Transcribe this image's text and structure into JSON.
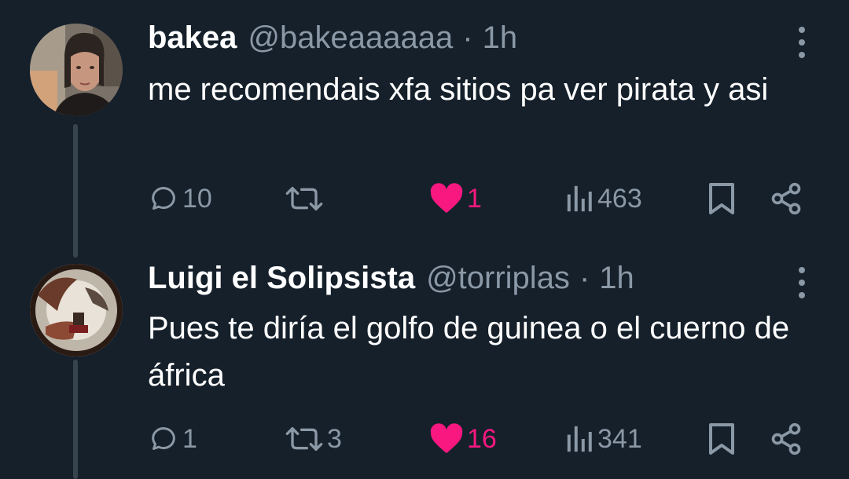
{
  "tweets": [
    {
      "name": "bakea",
      "handle": "@bakeaaaaaa",
      "separator": "·",
      "time": "1h",
      "text": "me recomendais xfa sitios pa ver pirata y asi",
      "replies": "10",
      "retweets": "",
      "likes": "1",
      "views": "463",
      "liked": true
    },
    {
      "name": "Luigi el Solipsista",
      "handle": "@torriplas",
      "separator": "·",
      "time": "1h",
      "text": "Pues te diría el golfo de guinea o el cuerno de áfrica",
      "replies": "1",
      "retweets": "3",
      "likes": "16",
      "views": "341",
      "liked": true
    }
  ],
  "icons": {
    "reply": "reply-icon",
    "retweet": "retweet-icon",
    "like": "heart-icon",
    "views": "views-icon",
    "bookmark": "bookmark-icon",
    "share": "share-icon",
    "more": "more-icon"
  },
  "colors": {
    "background": "#15202b",
    "text_primary": "#ffffff",
    "text_secondary": "#8b98a5",
    "like_pink": "#f91880",
    "thread_line": "#38444d"
  }
}
